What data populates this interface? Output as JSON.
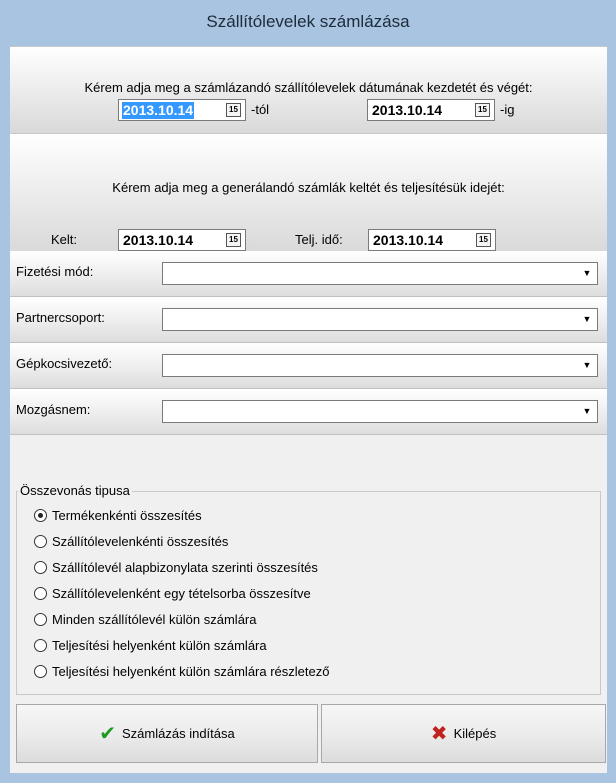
{
  "window": {
    "title": "Szállítólevelek számlázása"
  },
  "range_panel": {
    "message": "Kérem adja meg a számlázandó szállítólevelek dátumának kezdetét és végét:",
    "from_date": "2013.10.14",
    "from_suffix": "-tól",
    "to_date": "2013.10.14",
    "to_suffix": "-ig"
  },
  "invoice_panel": {
    "message": "Kérem adja meg a generálandó számlák keltét és teljesítésük idejét:",
    "issue_label": "Kelt:",
    "issue_date": "2013.10.14",
    "perf_label": "Telj. idő:",
    "perf_date": "2013.10.14"
  },
  "calendar_icon_text": "15",
  "fields": [
    {
      "label": "Fizetési mód:",
      "value": ""
    },
    {
      "label": "Partnercsoport:",
      "value": ""
    },
    {
      "label": "Gépkocsivezető:",
      "value": ""
    },
    {
      "label": "Mozgásnem:",
      "value": ""
    }
  ],
  "merge_group": {
    "title": "Összevonás tipusa",
    "selected_index": 0,
    "options": [
      "Termékenkénti összesítés",
      "Szállítólevelenkénti összesítés",
      "Szállítólevél alapbizonylata szerinti összesítés",
      "Szállítólevelenként egy tételsorba összesítve",
      "Minden szállítólevél külön számlára",
      "Teljesítési helyenként külön számlára",
      "Teljesítési helyenként külön számlára részletező"
    ]
  },
  "buttons": {
    "start": {
      "label": "Számlázás indítása",
      "icon": "check-icon",
      "icon_color": "#1e9a1e"
    },
    "exit": {
      "label": "Kilépés",
      "icon": "x-icon",
      "icon_color": "#c0221e"
    }
  },
  "colors": {
    "title_bar": "#a8c4e0",
    "selection": "#3399ff"
  }
}
